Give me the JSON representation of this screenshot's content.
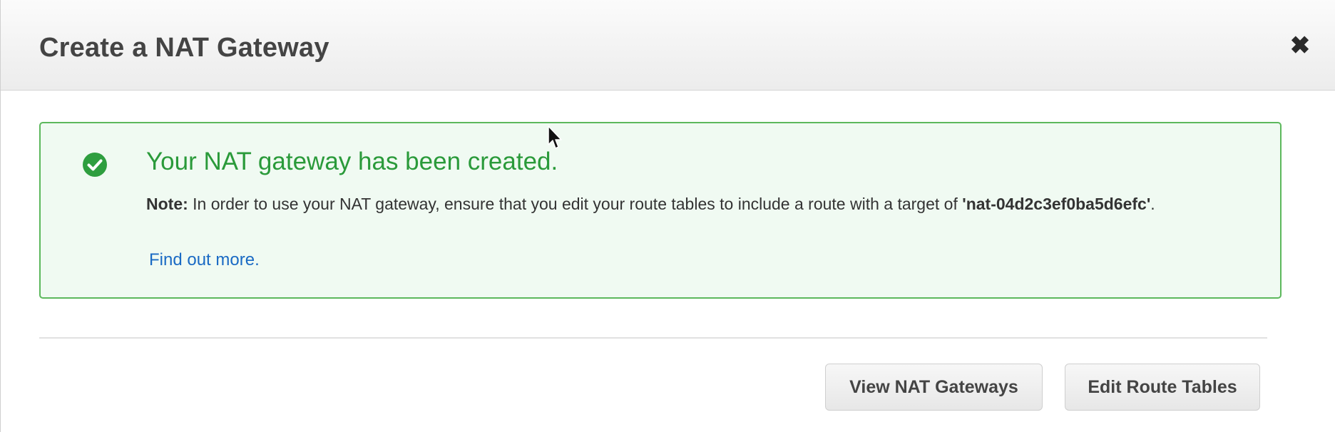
{
  "dialog": {
    "title": "Create a NAT Gateway",
    "close_label": "✖"
  },
  "alert": {
    "icon": "check-circle-icon",
    "title": "Your NAT gateway has been created.",
    "note_label": "Note:",
    "note_text": " In order to use your NAT gateway, ensure that you edit your route tables to include a route with a target of ",
    "gateway_id": "'nat-04d2c3ef0ba5d6efc'",
    "note_end": ".",
    "link_text": "Find out more.",
    "colors": {
      "border": "#5cb85c",
      "background": "#f0faf2",
      "title": "#2a9a3a",
      "link": "#1a6ac4"
    }
  },
  "footer": {
    "view_button": "View NAT Gateways",
    "edit_button": "Edit Route Tables"
  }
}
